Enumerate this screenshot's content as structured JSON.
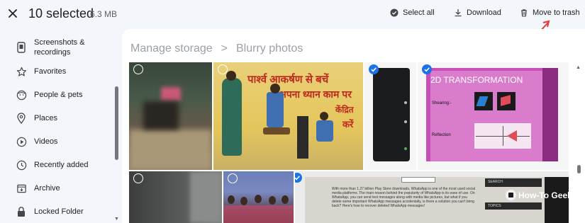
{
  "topbar": {
    "close_icon": "close-icon",
    "title": "10 selected",
    "size": "6.3 MB",
    "actions": [
      {
        "label": "Select all",
        "icon": "check-circle-icon"
      },
      {
        "label": "Download",
        "icon": "download-icon"
      },
      {
        "label": "Move to trash",
        "icon": "trash-icon"
      }
    ]
  },
  "sidebar": {
    "items": [
      {
        "label": "Screenshots & recordings",
        "icon": "phone-icon"
      },
      {
        "label": "Favorites",
        "icon": "star-icon"
      },
      {
        "label": "People & pets",
        "icon": "face-icon"
      },
      {
        "label": "Places",
        "icon": "pin-icon"
      },
      {
        "label": "Videos",
        "icon": "play-icon"
      },
      {
        "label": "Recently added",
        "icon": "clock-icon"
      },
      {
        "label": "Archive",
        "icon": "archive-icon"
      },
      {
        "label": "Locked Folder",
        "icon": "lock-icon"
      }
    ]
  },
  "breadcrumb": {
    "root": "Manage storage",
    "separator": ">",
    "current": "Blurry photos"
  },
  "photos": {
    "p3_hindi_1": "पार्श्व आकर्षण से बचें",
    "p3_hindi_2": "अपना ध्यान काम पर",
    "p3_hindi_3": "केंद्रित",
    "p3_hindi_4": "करें",
    "p5_title": "2D TRANSFORMATION",
    "p5_label1": "Shearing:-",
    "p5_label2": "Reflection",
    "p8_text": "With more than 1.27 billion Play Store downloads, WhatsApp is one of the most used social media platforms. The main reason behind the popularity of WhatsApp is its ease of use. On WhatsApp, you can send text messages along with media like pictures, but what if you delete some important WhatsApp messages accidentally, is there a solution you can't bring back? Here's how to recover deleted WhatsApp messages!",
    "p8_side_1": "SEARCH",
    "p8_side_2": "TOPICS"
  },
  "watermark": "How-To Geek",
  "colors": {
    "accent": "#1a73e8",
    "arrow": "#e53935",
    "background": "#f3f6fb"
  }
}
